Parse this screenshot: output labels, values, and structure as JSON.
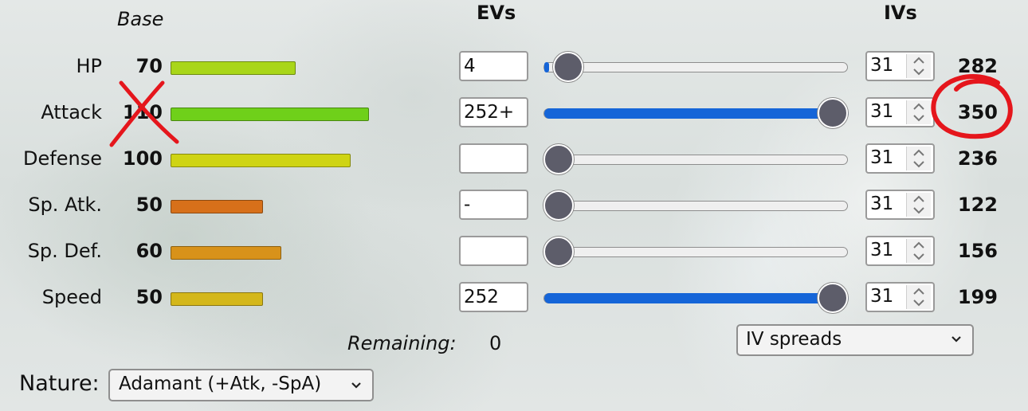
{
  "headers": {
    "base": "Base",
    "evs": "EVs",
    "ivs": "IVs"
  },
  "stats": [
    {
      "label": "HP",
      "base": "70",
      "ev": "4",
      "iv": "31",
      "total": "282",
      "bar_color": "#a9d619",
      "bar_fraction": 0.27,
      "slider_fraction": 0.016
    },
    {
      "label": "Attack",
      "base": "110",
      "ev": "252+",
      "iv": "31",
      "total": "350",
      "bar_color": "#6fd01a",
      "bar_fraction": 0.43,
      "slider_fraction": 1.0
    },
    {
      "label": "Defense",
      "base": "100",
      "ev": "",
      "iv": "31",
      "total": "236",
      "bar_color": "#cfd414",
      "bar_fraction": 0.39,
      "slider_fraction": 0.0
    },
    {
      "label": "Sp. Atk.",
      "base": "50",
      "ev": "-",
      "iv": "31",
      "total": "122",
      "bar_color": "#d7701a",
      "bar_fraction": 0.2,
      "slider_fraction": 0.0
    },
    {
      "label": "Sp. Def.",
      "base": "60",
      "ev": "",
      "iv": "31",
      "total": "156",
      "bar_color": "#d8921a",
      "bar_fraction": 0.24,
      "slider_fraction": 0.0
    },
    {
      "label": "Speed",
      "base": "50",
      "ev": "252",
      "iv": "31",
      "total": "199",
      "bar_color": "#d4b71a",
      "bar_fraction": 0.2,
      "slider_fraction": 1.0
    }
  ],
  "remaining": {
    "label": "Remaining:",
    "value": "0"
  },
  "iv_spreads": {
    "selected": "IV spreads"
  },
  "nature": {
    "label": "Nature:",
    "selected": "Adamant (+Atk, -SpA)"
  },
  "annotations": {
    "color": "#e5161c",
    "cross_icon": "red-x-mark",
    "circle_icon": "red-scribble-circle"
  },
  "colors": {
    "slider_fill": "#1565d8",
    "slider_thumb": "#5d5d6a"
  }
}
